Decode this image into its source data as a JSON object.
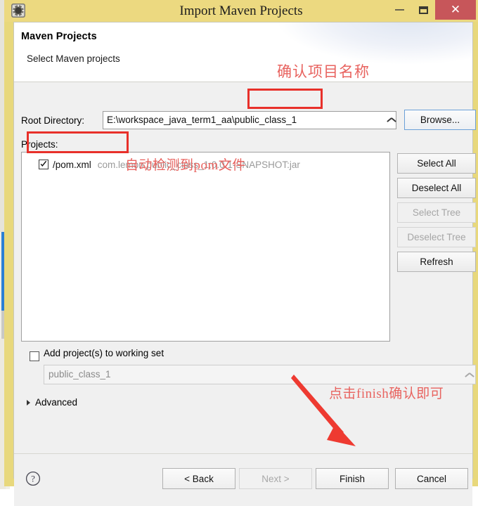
{
  "window": {
    "title": "Import Maven Projects",
    "icon": "maven-gear-icon",
    "minimize_label": "—",
    "maximize_label": "□",
    "close_label": "✕",
    "frame_color": "#ecd980",
    "close_button_color": "#c7565a"
  },
  "header": {
    "title": "Maven Projects",
    "subtitle": "Select Maven projects"
  },
  "form": {
    "root_directory_label": "Root Directory:",
    "root_directory_value": "E:\\workspace_java_term1_aa\\public_class_1",
    "browse_label": "Browse...",
    "projects_label": "Projects:"
  },
  "projects": [
    {
      "checked": true,
      "name": "/pom.xml",
      "coordinates": "com.lemon:public_class_1:0.0.1-SNAPSHOT:jar"
    }
  ],
  "side_buttons": [
    {
      "label": "Select All",
      "enabled": true
    },
    {
      "label": "Deselect All",
      "enabled": true
    },
    {
      "label": "Select Tree",
      "enabled": false
    },
    {
      "label": "Deselect Tree",
      "enabled": false
    },
    {
      "label": "Refresh",
      "enabled": true
    }
  ],
  "working_set": {
    "checkbox_label": "Add project(s) to working set",
    "checked": false,
    "combo_value": "public_class_1",
    "enabled": false
  },
  "advanced": {
    "label": "Advanced",
    "expanded": false
  },
  "footer": {
    "help_icon": "help-question-icon",
    "buttons": [
      {
        "label": "< Back",
        "enabled": true,
        "default": false
      },
      {
        "label": "Next >",
        "enabled": false,
        "default": false
      },
      {
        "label": "Finish",
        "enabled": true,
        "default": true
      },
      {
        "label": "Cancel",
        "enabled": true,
        "default": false
      }
    ]
  },
  "annotations": {
    "color": "#e8635f",
    "box_color": "#e8302a",
    "confirm_project_name": "确认项目名称",
    "auto_detect_pom": "自动检测到pom文件",
    "click_finish": "点击finish确认即可"
  }
}
